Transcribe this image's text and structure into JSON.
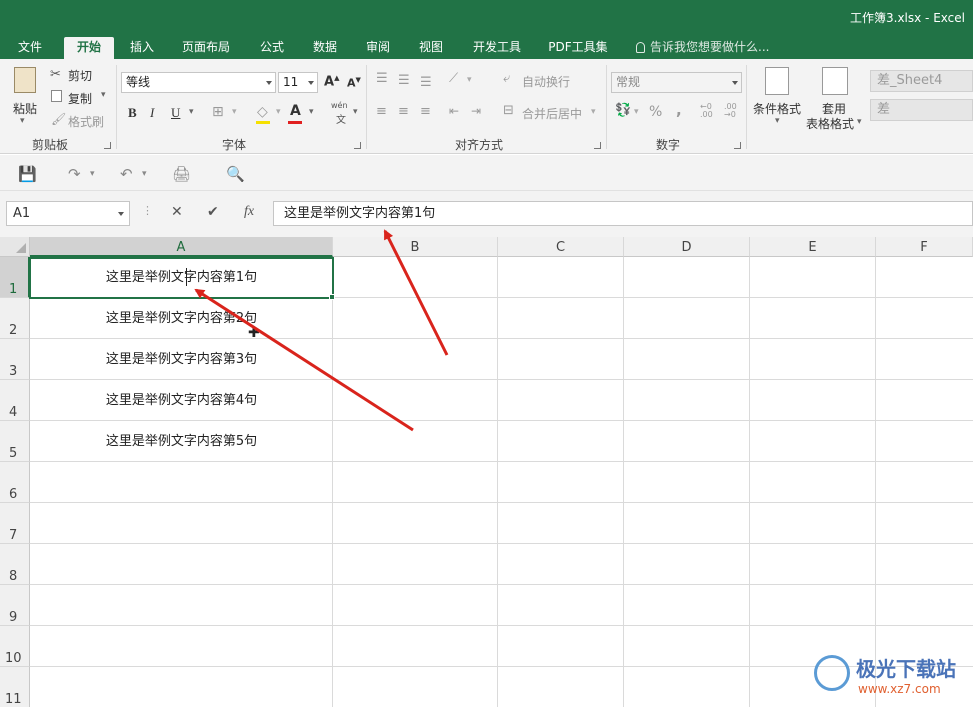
{
  "window": {
    "title": "工作簿3.xlsx - Excel"
  },
  "tabs": [
    "文件",
    "开始",
    "插入",
    "页面布局",
    "公式",
    "数据",
    "审阅",
    "视图",
    "开发工具",
    "PDF工具集"
  ],
  "tell_me": "告诉我您想要做什么...",
  "ribbon": {
    "clipboard": {
      "paste": "粘贴",
      "cut": "剪切",
      "copy": "复制",
      "format_painter": "格式刷",
      "label": "剪贴板"
    },
    "font": {
      "name": "等线",
      "size": "11",
      "bold": "B",
      "italic": "I",
      "underline": "U",
      "font_color": "A",
      "phonetic_top": "wén",
      "phonetic_bottom": "文",
      "grow": "A",
      "shrink": "A",
      "label": "字体"
    },
    "alignment": {
      "wrap": "自动换行",
      "merge": "合并后居中",
      "label": "对齐方式"
    },
    "number": {
      "format": "常规",
      "percent": "%",
      "comma": ",",
      "label": "数字"
    },
    "styles": {
      "conditional": "条件格式",
      "table_line1": "套用",
      "table_line2": "表格格式",
      "style1": "差_Sheet4",
      "style2": "差"
    }
  },
  "formula_bar": {
    "name_box": "A1",
    "cancel": "✕",
    "enter": "✔",
    "fx": "fx",
    "content": "这里是举例文字内容第1句"
  },
  "sheet": {
    "columns": [
      "A",
      "B",
      "C",
      "D",
      "E",
      "F"
    ],
    "rows": [
      "1",
      "2",
      "3",
      "4",
      "5",
      "6",
      "7",
      "8",
      "9",
      "10",
      "11"
    ],
    "cells": {
      "A1": "这里是举例文字内容第1句",
      "A2": "这里是举例文字内容第2句",
      "A3": "这里是举例文字内容第3句",
      "A4": "这里是举例文字内容第4句",
      "A5": "这里是举例文字内容第5句"
    },
    "selected": "A1"
  },
  "colors": {
    "accent": "#217346",
    "annotation": "#d9241c"
  },
  "watermark": {
    "name": "极光下载站",
    "url": "www.xz7.com"
  }
}
